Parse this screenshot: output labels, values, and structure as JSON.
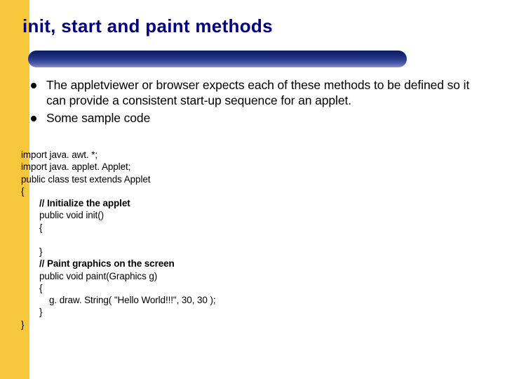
{
  "title": "init, start and paint methods",
  "bullets": [
    "The appletviewer or browser expects each of these methods to be defined so it can provide a consistent start-up sequence for an applet.",
    "Some sample code"
  ],
  "code": {
    "l1": "import java. awt. *;",
    "l2": "import java. applet. Applet;",
    "l3": "public class test extends Applet",
    "l4": "{",
    "l5": "// Initialize the applet",
    "l6": "public void init()",
    "l7": "{",
    "l8": "}",
    "l9": "// Paint graphics on the screen",
    "l10": "public void paint(Graphics g)",
    "l11": "{",
    "l12": "g. draw. String( \"Hello World!!!\", 30, 30 );",
    "l13": "}",
    "l14": "}"
  }
}
